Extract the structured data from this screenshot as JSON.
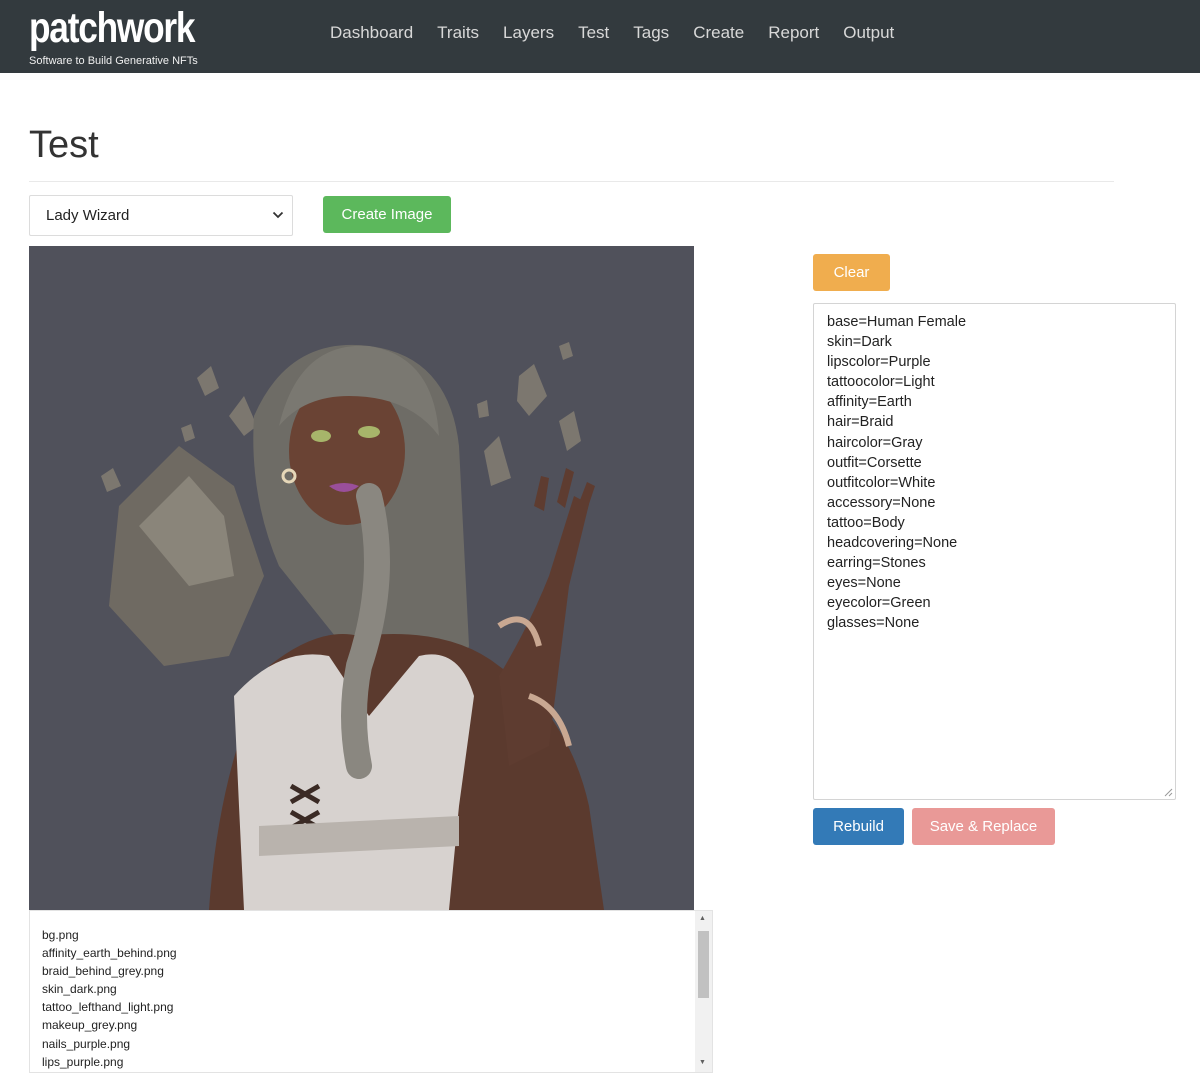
{
  "brand": {
    "name": "patchwork",
    "tagline": "Software to Build Generative NFTs"
  },
  "nav": {
    "items": [
      "Dashboard",
      "Traits",
      "Layers",
      "Test",
      "Tags",
      "Create",
      "Report",
      "Output"
    ]
  },
  "page": {
    "title": "Test"
  },
  "controls": {
    "collection_select": "Lady Wizard",
    "create_image_label": "Create Image",
    "clear_label": "Clear",
    "rebuild_label": "Rebuild",
    "save_replace_label": "Save & Replace"
  },
  "traits": [
    "base=Human Female",
    "skin=Dark",
    "lipscolor=Purple",
    "tattoocolor=Light",
    "affinity=Earth",
    "hair=Braid",
    "haircolor=Gray",
    "outfit=Corsette",
    "outfitcolor=White",
    "accessory=None",
    "tattoo=Body",
    "headcovering=None",
    "earring=Stones",
    "eyes=None",
    "eyecolor=Green",
    "glasses=None"
  ],
  "layers": [
    "bg.png",
    "affinity_earth_behind.png",
    "braid_behind_grey.png",
    "skin_dark.png",
    "tattoo_lefthand_light.png",
    "makeup_grey.png",
    "nails_purple.png",
    "lips_purple.png"
  ],
  "colors": {
    "navbar": "#333a3e",
    "success": "#5cb85c",
    "warning": "#f0ad4e",
    "primary": "#337ab7",
    "danger_light": "#e99997",
    "preview_bg": "#50515b"
  },
  "icons": {
    "select_caret": "chevron-down-icon"
  }
}
